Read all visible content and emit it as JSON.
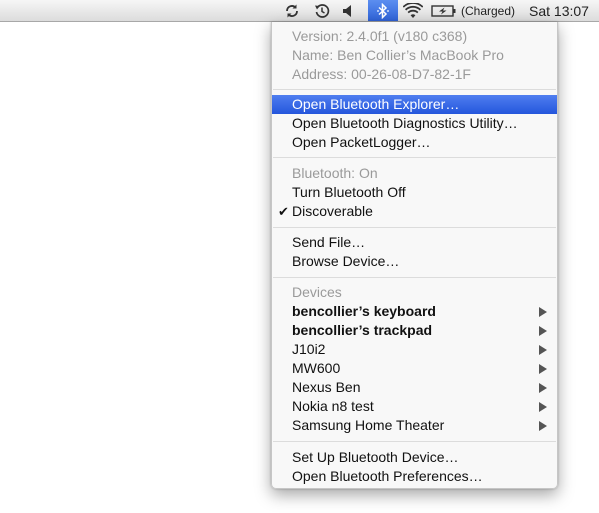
{
  "menubar": {
    "icons": [
      "sync-icon",
      "time-machine-icon",
      "volume-icon",
      "bluetooth-icon",
      "wifi-icon",
      "battery-icon"
    ],
    "battery_status": "(Charged)",
    "clock": "Sat 13:07"
  },
  "menu": {
    "version": "Version: 2.4.0f1 (v180 c368)",
    "name": "Name: Ben Collier’s MacBook Pro",
    "address": "Address: 00-26-08-D7-82-1F",
    "open_explorer": "Open Bluetooth Explorer…",
    "open_diagnostics": "Open Bluetooth Diagnostics Utility…",
    "open_packetlogger": "Open PacketLogger…",
    "bluetooth_status": "Bluetooth: On",
    "turn_off": "Turn Bluetooth Off",
    "discoverable": "Discoverable",
    "check_mark": "✔",
    "send_file": "Send File…",
    "browse_device": "Browse Device…",
    "devices_header": "Devices",
    "devices": [
      {
        "name": "bencollier’s keyboard",
        "bold": true
      },
      {
        "name": "bencollier’s trackpad",
        "bold": true
      },
      {
        "name": "J10i2",
        "bold": false
      },
      {
        "name": "MW600",
        "bold": false
      },
      {
        "name": "Nexus Ben",
        "bold": false
      },
      {
        "name": "Nokia n8 test",
        "bold": false
      },
      {
        "name": "Samsung Home Theater",
        "bold": false
      }
    ],
    "set_up_device": "Set Up Bluetooth Device…",
    "open_preferences": "Open Bluetooth Preferences…"
  },
  "colors": {
    "highlight": "#2f63d8",
    "disabled_text": "#9a9a9a"
  }
}
